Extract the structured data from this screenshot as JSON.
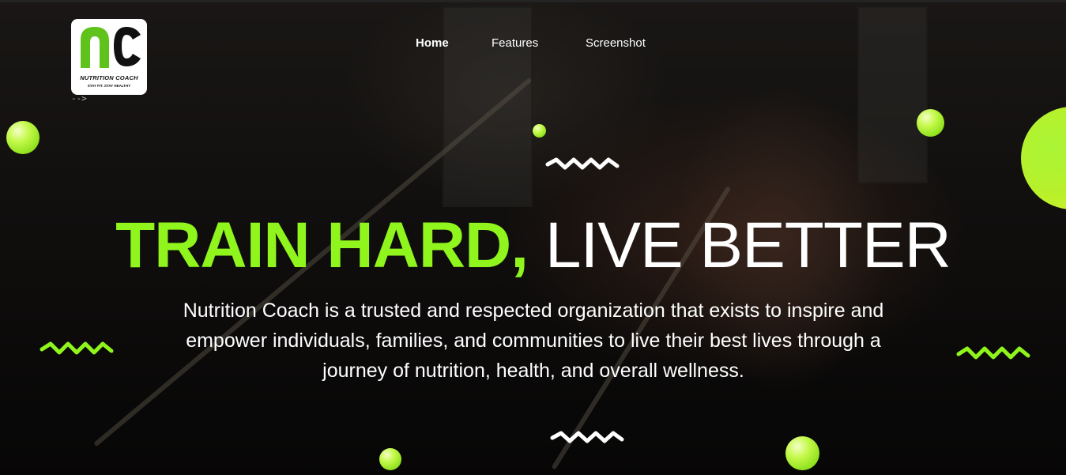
{
  "brand": {
    "logo_text": "NUTRITION COACH",
    "logo_tagline": "STAY FIT. STAY HEALTHY",
    "stray_text": "-->"
  },
  "nav": {
    "items": [
      {
        "label": "Home",
        "active": true
      },
      {
        "label": "Features",
        "active": false
      },
      {
        "label": "Screenshot",
        "active": false
      }
    ]
  },
  "hero": {
    "headline_accent": "TRAIN HARD,",
    "headline_rest": "LIVE BETTER",
    "description": "Nutrition Coach is a trusted and respected organization that exists to inspire and empower individuals, families, and communities to live their best lives through a journey of nutrition, health, and overall wellness."
  },
  "theme": {
    "accent": "#8ff51c",
    "ball_color": "#b8f02a",
    "text": "#ffffff"
  }
}
